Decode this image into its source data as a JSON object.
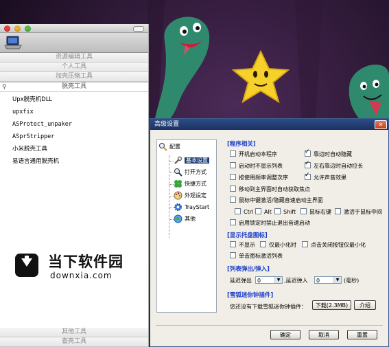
{
  "launcher": {
    "categories": [
      "资源编辑工具",
      "个人工具",
      "加壳压缩工具",
      "脱壳工具"
    ],
    "search_placeholder": "",
    "tools": [
      "Upx脱壳机DLL",
      "upxfix",
      "ASProtect_unpaker",
      "ASprStripper",
      "小米脱壳工具",
      "易语言通用脱壳机"
    ],
    "bottom_categories": [
      "其他工具",
      "查壳工具"
    ],
    "watermark": {
      "cn": "当下软件园",
      "en": "downxia.com"
    }
  },
  "dialog": {
    "title": "高级设置",
    "close": "✕",
    "tree": {
      "root": "配置",
      "items": [
        "基本设置",
        "打开方式",
        "快捷方式",
        "外观设定",
        "TrayStart",
        "其他"
      ]
    },
    "program": {
      "header": "[程序相关]",
      "options": [
        {
          "label": "开机启动本程序",
          "checked": false
        },
        {
          "label": "靠边时自动隐藏",
          "checked": true
        },
        {
          "label": "启动时不显示列表",
          "checked": false
        },
        {
          "label": "左右靠边时自动拉长",
          "checked": true
        },
        {
          "label": "按使用频率调整次序",
          "checked": false
        },
        {
          "label": "允许声音效果",
          "checked": true
        },
        {
          "label": "移动到主界面时自动获取焦点",
          "checked": false
        },
        {
          "label": "鼠标中键激活/隐藏音速启动主界面",
          "checked": false
        },
        {
          "label": "Ctrl",
          "checked": false
        },
        {
          "label": "Alt",
          "checked": false
        },
        {
          "label": "Shift",
          "checked": false
        },
        {
          "label": "鼠标右键",
          "checked": false
        },
        {
          "label": "激活于鼠标中间",
          "checked": false
        },
        {
          "label": "启用锁定时禁止退出音速启动",
          "checked": false
        }
      ]
    },
    "tray": {
      "header": "[显示托盘图标]",
      "options": [
        {
          "label": "不显示",
          "checked": false
        },
        {
          "label": "仅最小化时",
          "checked": false
        },
        {
          "label": "点击关闭按钮仅最小化",
          "checked": false
        },
        {
          "label": "单击图标激活列表",
          "checked": false
        }
      ]
    },
    "popup": {
      "header": "[列表弹出/弹入]",
      "delay_out_label": "延迟弹出",
      "delay_out_value": "0",
      "delay_in_label": ",延迟弹入",
      "delay_in_value": "0",
      "unit": "(毫秒)"
    },
    "plugin": {
      "header": "[雪狐迷你钟插件]",
      "text": "您还没有下载雪狐迷你钟插件：",
      "download_label": "下载(2.3MB)",
      "intro_label": "介绍"
    },
    "buttons": {
      "ok": "确定",
      "cancel": "取消",
      "reset": "重置"
    }
  }
}
